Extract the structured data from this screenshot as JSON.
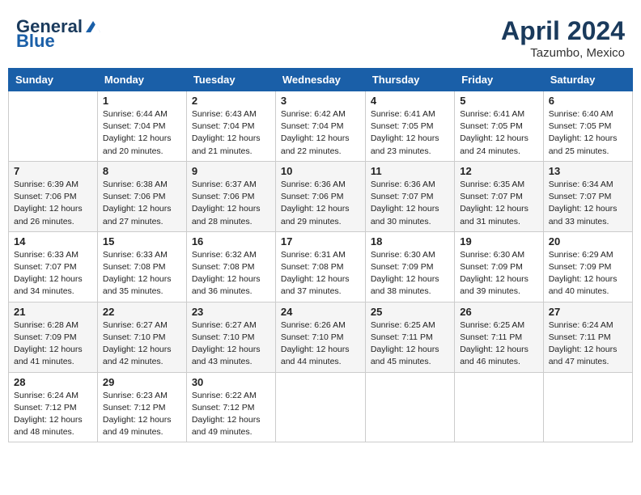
{
  "header": {
    "logo_line1": "General",
    "logo_line2": "Blue",
    "month": "April 2024",
    "location": "Tazumbo, Mexico"
  },
  "weekdays": [
    "Sunday",
    "Monday",
    "Tuesday",
    "Wednesday",
    "Thursday",
    "Friday",
    "Saturday"
  ],
  "weeks": [
    [
      {
        "day": "",
        "info": ""
      },
      {
        "day": "1",
        "info": "Sunrise: 6:44 AM\nSunset: 7:04 PM\nDaylight: 12 hours\nand 20 minutes."
      },
      {
        "day": "2",
        "info": "Sunrise: 6:43 AM\nSunset: 7:04 PM\nDaylight: 12 hours\nand 21 minutes."
      },
      {
        "day": "3",
        "info": "Sunrise: 6:42 AM\nSunset: 7:04 PM\nDaylight: 12 hours\nand 22 minutes."
      },
      {
        "day": "4",
        "info": "Sunrise: 6:41 AM\nSunset: 7:05 PM\nDaylight: 12 hours\nand 23 minutes."
      },
      {
        "day": "5",
        "info": "Sunrise: 6:41 AM\nSunset: 7:05 PM\nDaylight: 12 hours\nand 24 minutes."
      },
      {
        "day": "6",
        "info": "Sunrise: 6:40 AM\nSunset: 7:05 PM\nDaylight: 12 hours\nand 25 minutes."
      }
    ],
    [
      {
        "day": "7",
        "info": "Sunrise: 6:39 AM\nSunset: 7:06 PM\nDaylight: 12 hours\nand 26 minutes."
      },
      {
        "day": "8",
        "info": "Sunrise: 6:38 AM\nSunset: 7:06 PM\nDaylight: 12 hours\nand 27 minutes."
      },
      {
        "day": "9",
        "info": "Sunrise: 6:37 AM\nSunset: 7:06 PM\nDaylight: 12 hours\nand 28 minutes."
      },
      {
        "day": "10",
        "info": "Sunrise: 6:36 AM\nSunset: 7:06 PM\nDaylight: 12 hours\nand 29 minutes."
      },
      {
        "day": "11",
        "info": "Sunrise: 6:36 AM\nSunset: 7:07 PM\nDaylight: 12 hours\nand 30 minutes."
      },
      {
        "day": "12",
        "info": "Sunrise: 6:35 AM\nSunset: 7:07 PM\nDaylight: 12 hours\nand 31 minutes."
      },
      {
        "day": "13",
        "info": "Sunrise: 6:34 AM\nSunset: 7:07 PM\nDaylight: 12 hours\nand 33 minutes."
      }
    ],
    [
      {
        "day": "14",
        "info": "Sunrise: 6:33 AM\nSunset: 7:07 PM\nDaylight: 12 hours\nand 34 minutes."
      },
      {
        "day": "15",
        "info": "Sunrise: 6:33 AM\nSunset: 7:08 PM\nDaylight: 12 hours\nand 35 minutes."
      },
      {
        "day": "16",
        "info": "Sunrise: 6:32 AM\nSunset: 7:08 PM\nDaylight: 12 hours\nand 36 minutes."
      },
      {
        "day": "17",
        "info": "Sunrise: 6:31 AM\nSunset: 7:08 PM\nDaylight: 12 hours\nand 37 minutes."
      },
      {
        "day": "18",
        "info": "Sunrise: 6:30 AM\nSunset: 7:09 PM\nDaylight: 12 hours\nand 38 minutes."
      },
      {
        "day": "19",
        "info": "Sunrise: 6:30 AM\nSunset: 7:09 PM\nDaylight: 12 hours\nand 39 minutes."
      },
      {
        "day": "20",
        "info": "Sunrise: 6:29 AM\nSunset: 7:09 PM\nDaylight: 12 hours\nand 40 minutes."
      }
    ],
    [
      {
        "day": "21",
        "info": "Sunrise: 6:28 AM\nSunset: 7:09 PM\nDaylight: 12 hours\nand 41 minutes."
      },
      {
        "day": "22",
        "info": "Sunrise: 6:27 AM\nSunset: 7:10 PM\nDaylight: 12 hours\nand 42 minutes."
      },
      {
        "day": "23",
        "info": "Sunrise: 6:27 AM\nSunset: 7:10 PM\nDaylight: 12 hours\nand 43 minutes."
      },
      {
        "day": "24",
        "info": "Sunrise: 6:26 AM\nSunset: 7:10 PM\nDaylight: 12 hours\nand 44 minutes."
      },
      {
        "day": "25",
        "info": "Sunrise: 6:25 AM\nSunset: 7:11 PM\nDaylight: 12 hours\nand 45 minutes."
      },
      {
        "day": "26",
        "info": "Sunrise: 6:25 AM\nSunset: 7:11 PM\nDaylight: 12 hours\nand 46 minutes."
      },
      {
        "day": "27",
        "info": "Sunrise: 6:24 AM\nSunset: 7:11 PM\nDaylight: 12 hours\nand 47 minutes."
      }
    ],
    [
      {
        "day": "28",
        "info": "Sunrise: 6:24 AM\nSunset: 7:12 PM\nDaylight: 12 hours\nand 48 minutes."
      },
      {
        "day": "29",
        "info": "Sunrise: 6:23 AM\nSunset: 7:12 PM\nDaylight: 12 hours\nand 49 minutes."
      },
      {
        "day": "30",
        "info": "Sunrise: 6:22 AM\nSunset: 7:12 PM\nDaylight: 12 hours\nand 49 minutes."
      },
      {
        "day": "",
        "info": ""
      },
      {
        "day": "",
        "info": ""
      },
      {
        "day": "",
        "info": ""
      },
      {
        "day": "",
        "info": ""
      }
    ]
  ]
}
